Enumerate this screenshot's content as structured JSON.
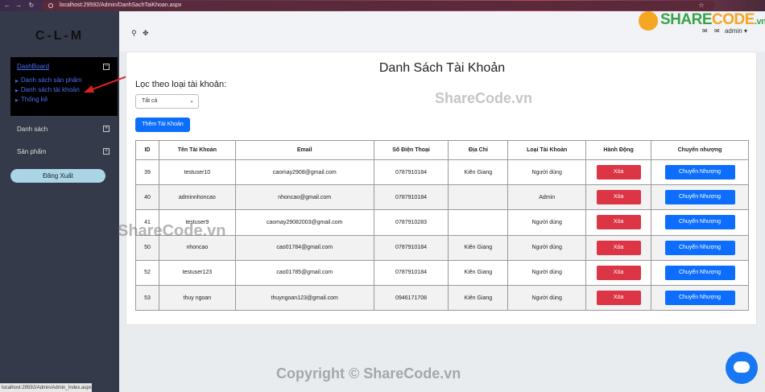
{
  "browser": {
    "url": "localhost:29592/Admin/DanhSachTaiKhoan.aspx"
  },
  "sidebar": {
    "brand": "C-L-M",
    "dashboard": {
      "title": "DashBoard",
      "items": [
        "Danh sách sản phẩm",
        "Danh sách tài khoản",
        "Thống kê"
      ]
    },
    "sections": [
      "Danh sách",
      "Sản phẩm"
    ],
    "logout_label": "Đăng Xuất"
  },
  "topbar": {
    "user_label": "admin"
  },
  "status_bar": {
    "url": "localhost:29592/Admin/Admin_Index.aspx"
  },
  "main": {
    "title": "Danh Sách Tài Khoản",
    "filter_label": "Lọc theo loại tài khoản:",
    "filter_value": "Tất cả",
    "add_button": "Thêm Tài Khoản",
    "table": {
      "headers": [
        "ID",
        "Tên Tài Khoản",
        "Email",
        "Số Điện Thoại",
        "Địa Chỉ",
        "Loại Tài Khoản",
        "Hành Động",
        "Chuyển nhượng"
      ],
      "delete_label": "Xóa",
      "transfer_label": "Chuyển Nhượng",
      "rows": [
        {
          "id": "39",
          "name": "testuser10",
          "email": "caomay2908@gmail.com",
          "phone": "0787910184",
          "address": "Kiên Giang",
          "type": "Người dùng"
        },
        {
          "id": "40",
          "name": "adminnhoncao",
          "email": "nhoncao@gmail.com",
          "phone": "0787910184",
          "address": "",
          "type": "Admin"
        },
        {
          "id": "41",
          "name": "testuser9",
          "email": "caomay29082003@gmail.com",
          "phone": "0787910283",
          "address": "",
          "type": "Người dùng"
        },
        {
          "id": "50",
          "name": "nhoncao",
          "email": "cao01784@gmail.com",
          "phone": "0787910184",
          "address": "Kiên Giang",
          "type": "Người dùng"
        },
        {
          "id": "52",
          "name": "testuser123",
          "email": "cao01785@gmail.com",
          "phone": "0787910184",
          "address": "Kiên Giang",
          "type": "Người dùng"
        },
        {
          "id": "53",
          "name": "thuy ngoan",
          "email": "thuyngoan123@gmail.com",
          "phone": "0946171708",
          "address": "Kiên Giang",
          "type": "Người dùng"
        }
      ]
    }
  },
  "watermarks": {
    "logo_share": "SHARE",
    "logo_code": "CODE",
    "logo_suffix": ".vn",
    "center": "ShareCode.vn",
    "left": "ShareCode.vn",
    "copyright": "Copyright © ShareCode.vn"
  },
  "colors": {
    "danger": "#dc3545",
    "primary": "#0d6efd",
    "sidebar": "#343a4a"
  }
}
